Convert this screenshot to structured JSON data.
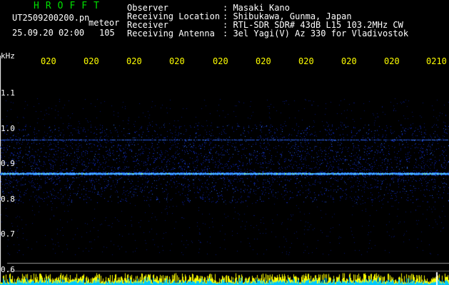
{
  "app": {
    "title": "HROFFT",
    "file_name": "UT2509200200.pn",
    "mode": "meteor",
    "datetime": "25.09.20 02:00",
    "count": "105"
  },
  "info": [
    {
      "label": "Observer",
      "value": ": Masaki Kano"
    },
    {
      "label": "Receiving Location",
      "value": ": Shibukawa, Gunma, Japan"
    },
    {
      "label": "Receiver",
      "value": ": RTL-SDR SDR# 43dB L15 103.2MHz CW"
    },
    {
      "label": "Receiving Antenna",
      "value": ": 3el Yagi(V) Az 330 for Vladivostok"
    }
  ],
  "axis": {
    "unit": "kHz",
    "yticks": [
      "1.1",
      "1.0",
      "0.9",
      "0.8",
      "0.7",
      "0.6"
    ],
    "xticks": [
      "020",
      "020",
      "020",
      "020",
      "020",
      "020",
      "020",
      "020",
      "020",
      "0210"
    ]
  },
  "colors": {
    "background": "#000000",
    "title": "#00e000",
    "time_labels": "#ffff00",
    "band_low": "#0a1ea0",
    "band_mid": "#1e5aff",
    "carrier": "#50c8ff",
    "hot": "#ffe600"
  }
}
